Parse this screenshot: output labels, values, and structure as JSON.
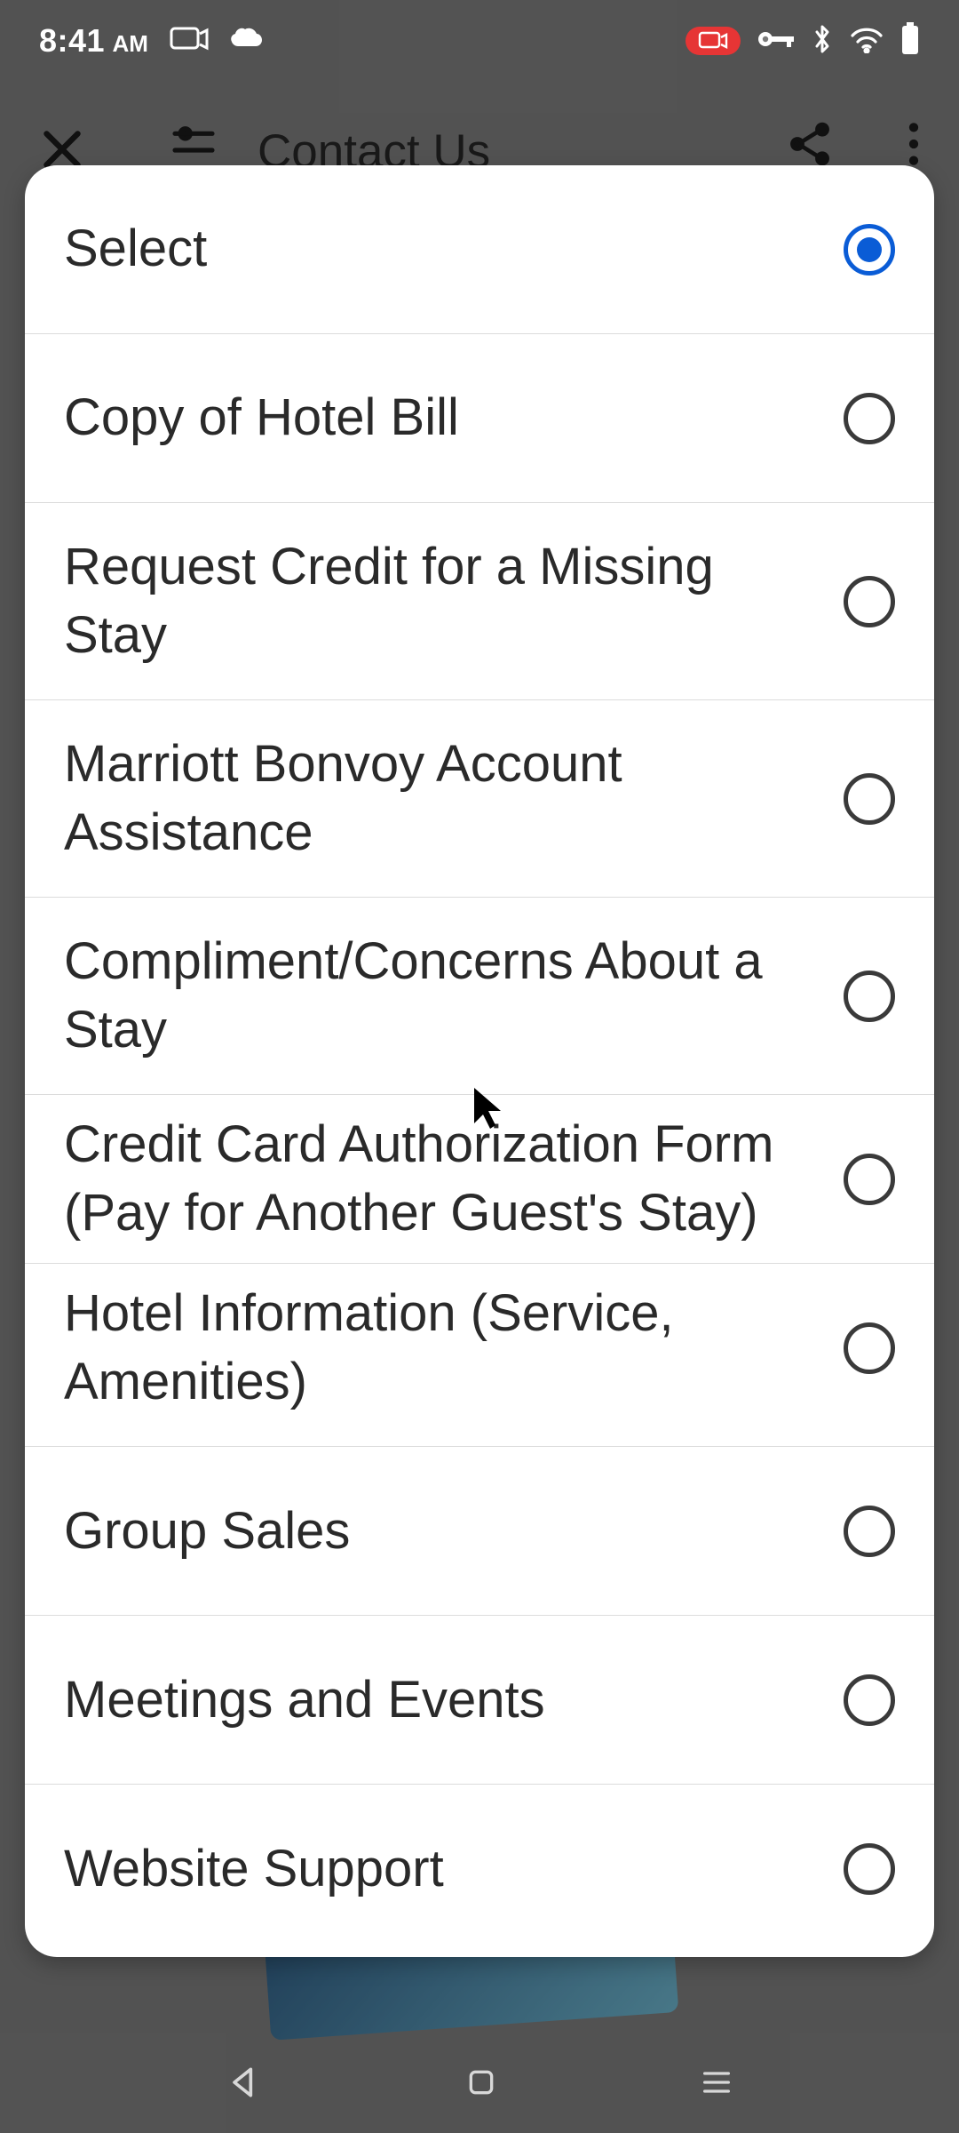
{
  "status": {
    "time": "8:41",
    "ampm": "AM"
  },
  "header": {
    "title": "Contact Us"
  },
  "options": [
    {
      "label": "Select",
      "selected": true
    },
    {
      "label": "Copy of Hotel Bill",
      "selected": false
    },
    {
      "label": "Request Credit for a Missing Stay",
      "selected": false
    },
    {
      "label": "Marriott Bonvoy Account Assistance",
      "selected": false
    },
    {
      "label": "Compliment/Concerns About a Stay",
      "selected": false
    },
    {
      "label": "Credit Card Authorization Form (Pay for Another Guest's Stay)",
      "selected": false
    },
    {
      "label": "Hotel Information (Service, Amenities)",
      "selected": false
    },
    {
      "label": "Group Sales",
      "selected": false
    },
    {
      "label": "Meetings and Events",
      "selected": false
    },
    {
      "label": "Website Support",
      "selected": false
    }
  ]
}
